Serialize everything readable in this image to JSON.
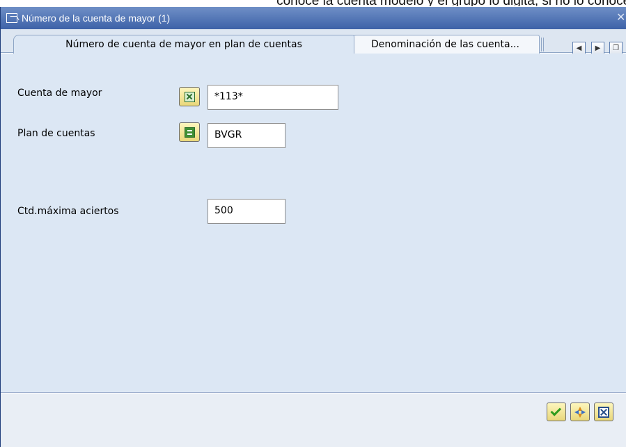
{
  "document_text": "conoce la cuenta modelo y el grupo lo digita, si no lo conoce p",
  "window": {
    "title": "Número de la cuenta de mayor (1)",
    "close_icon": "close-icon"
  },
  "tabs": [
    {
      "label": "Número de cuenta de mayor en plan de cuentas",
      "active": true
    },
    {
      "label": "Denominación de las cuenta...",
      "active": false
    }
  ],
  "tab_nav": {
    "left_icon": "arrow-left-icon",
    "right_icon": "arrow-right-icon",
    "list_icon": "tab-list-icon"
  },
  "form": {
    "cuenta_mayor": {
      "label": "Cuenta de mayor",
      "value": "*113*",
      "operator_icon": "pattern-match-icon"
    },
    "plan_cuentas": {
      "label": "Plan de cuentas",
      "value": "BVGR",
      "operator_icon": "equals-icon"
    },
    "max_aciertos": {
      "label": "Ctd.máxima aciertos",
      "value": "500"
    }
  },
  "footer": {
    "confirm_icon": "check-icon",
    "multiple_selection_icon": "compass-icon",
    "cancel_icon": "cancel-x-icon"
  },
  "colors": {
    "titlebar": "#3d62a8",
    "content_bg": "#dce7f4",
    "button_bg": "#f5e89a"
  }
}
